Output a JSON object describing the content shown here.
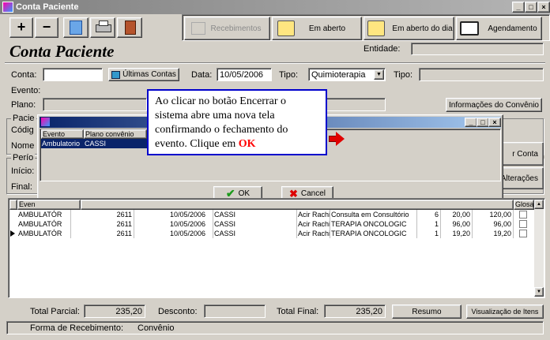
{
  "window": {
    "title": "Conta Paciente"
  },
  "toolbar": {
    "add": "+",
    "remove": "−",
    "recebimentos": "Recebimentos",
    "em_aberto": "Em aberto",
    "em_aberto_dia": "Em aberto do dia",
    "agendamento": "Agendamento"
  },
  "header": {
    "title": "Conta Paciente",
    "entidade_label": "Entidade:"
  },
  "form": {
    "conta_label": "Conta:",
    "ultimas_contas": "Últimas Contas",
    "data_label": "Data:",
    "data_value": "10/05/2006",
    "tipo_label": "Tipo:",
    "tipo_value": "Quimioterapia",
    "tipo2_label": "Tipo:",
    "evento_label": "Evento:",
    "plano_label": "Plano:",
    "info_convenio": "Informações do Convênio",
    "pacie_label": "Pacie",
    "codig_label": "Códig",
    "nome_label": "Nome",
    "perio_label": "Perío",
    "inicio_label": "Início:",
    "final_label": "Final:",
    "r_conta": "r Conta",
    "alteracoes": "Alterações"
  },
  "dialog": {
    "columns": [
      "Evento",
      "Plano convênio"
    ],
    "row": [
      "Ambulatorio",
      "CASSI"
    ],
    "ok": "OK",
    "cancel": "Cancel"
  },
  "callout": {
    "text": "Ao clicar no botão Encerrar o sistema abre uma nova tela confirmando o fechamento do evento. Clique em ",
    "highlight": "OK"
  },
  "grid": {
    "header_event": "Even",
    "header_glosa": "Glosa",
    "rows": [
      [
        "AMBULATÓR",
        "2611",
        "10/05/2006",
        "CASSI",
        "Acir Rachid F",
        "Consulta em Consultório",
        "6",
        "20,00",
        "120,00"
      ],
      [
        "AMBULATÓR",
        "2611",
        "10/05/2006",
        "CASSI",
        "Acir Rachid F",
        "TERAPIA ONCOLOGIC",
        "1",
        "96,00",
        "96,00"
      ],
      [
        "AMBULATÓR",
        "2611",
        "10/05/2006",
        "CASSI",
        "Acir Rachid F",
        "TERAPIA ONCOLOGIC",
        "1",
        "19,20",
        "19,20"
      ]
    ]
  },
  "footer": {
    "total_parcial_label": "Total Parcial:",
    "total_parcial": "235,20",
    "desconto_label": "Desconto:",
    "total_final_label": "Total Final:",
    "total_final": "235,20",
    "resumo": "Resumo",
    "visualizacao": "Visualização de Itens",
    "forma_label": "Forma de Recebimento:",
    "forma_value": "Convênio"
  },
  "colors": {
    "title_gradient_start": "#808080",
    "selection": "#0a246a",
    "callout_border": "#0000cc",
    "ok_red": "#ff0000"
  }
}
